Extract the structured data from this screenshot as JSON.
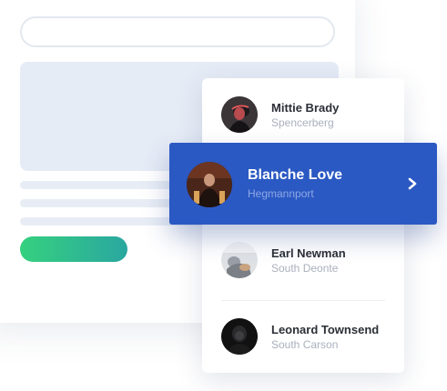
{
  "contacts": [
    {
      "name": "Mittie Brady",
      "city": "Spencerberg",
      "avatar_icon": "portrait-photo-icon"
    },
    {
      "name": "Blanche Love",
      "city": "Hegmannport",
      "avatar_icon": "portrait-photo-icon",
      "selected": true
    },
    {
      "name": "Earl Newman",
      "city": "South Deonte",
      "avatar_icon": "portrait-photo-icon"
    },
    {
      "name": "Leonard Townsend",
      "city": "South Carson",
      "avatar_icon": "portrait-photo-icon"
    }
  ],
  "selected_row_icon": "chevron-right-icon",
  "colors": {
    "accent": "#2b59c3",
    "accent_subtext": "#8da8e6",
    "cta_gradient_start": "#35d07f",
    "cta_gradient_end": "#2aa7a0",
    "placeholder_block": "#e6ecf6",
    "name_text": "#2b2f36",
    "city_text": "#a9b1bd"
  }
}
